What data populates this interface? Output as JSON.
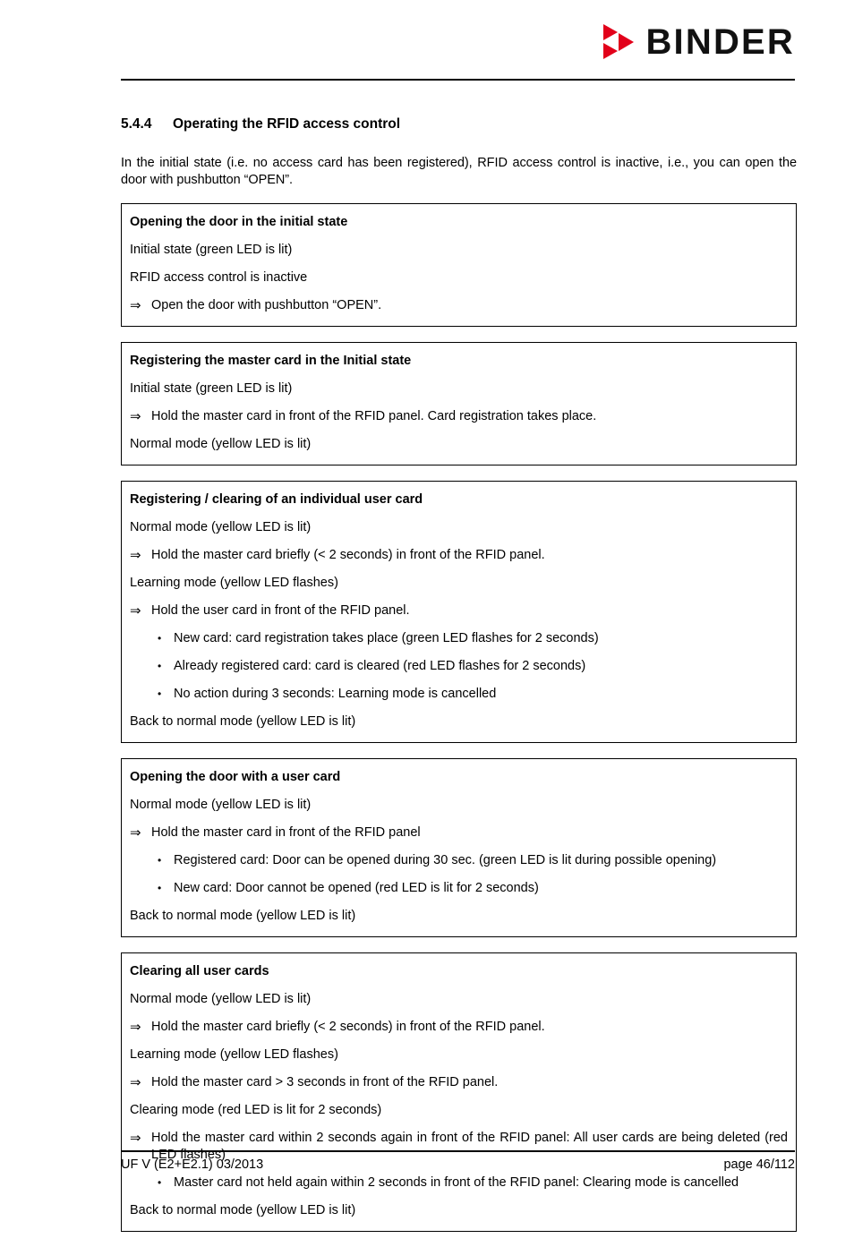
{
  "header": {
    "brand": "BINDER",
    "logo_color": "#e2001a",
    "logo_icon": "binder-triangles-logo"
  },
  "section": {
    "number": "5.4.4",
    "title": "Operating the RFID access control"
  },
  "intro": "In the initial state (i.e. no access card has been registered), RFID access control is inactive, i.e., you can open the door with pushbutton “OPEN”.",
  "glyphs": {
    "arrow": "⇒",
    "bullet": "•"
  },
  "boxes": [
    {
      "title": "Opening the door in the initial state",
      "lines": [
        {
          "type": "plain",
          "text": "Initial state (green LED is lit)"
        },
        {
          "type": "plain",
          "text": "RFID access control is inactive"
        },
        {
          "type": "arrow",
          "text": "Open the door with pushbutton “OPEN”."
        }
      ]
    },
    {
      "title": "Registering the master card in the Initial state",
      "lines": [
        {
          "type": "plain",
          "text": "Initial state (green LED is lit)"
        },
        {
          "type": "arrow",
          "text": "Hold the master card in front of the RFID panel. Card registration takes place."
        },
        {
          "type": "plain",
          "text": "Normal mode (yellow LED is lit)"
        }
      ]
    },
    {
      "title": "Registering / clearing of an individual user card",
      "lines": [
        {
          "type": "plain",
          "text": "Normal mode (yellow LED is lit)"
        },
        {
          "type": "arrow",
          "text": "Hold the master card briefly (< 2 seconds) in front of the RFID panel."
        },
        {
          "type": "plain",
          "text": "Learning mode (yellow LED flashes)"
        },
        {
          "type": "arrow",
          "text": "Hold the user card in front of the RFID panel."
        },
        {
          "type": "bullet",
          "text": "New card: card registration takes place (green LED flashes for 2 seconds)"
        },
        {
          "type": "bullet",
          "text": "Already registered card: card is cleared (red LED flashes for 2 seconds)"
        },
        {
          "type": "bullet",
          "text": "No action during 3 seconds: Learning mode is cancelled"
        },
        {
          "type": "plain",
          "text": "Back to normal mode (yellow LED is lit)"
        }
      ]
    },
    {
      "title": "Opening the door with a user card",
      "lines": [
        {
          "type": "plain",
          "text": "Normal mode (yellow LED is lit)"
        },
        {
          "type": "arrow",
          "text": "Hold the master card in front of the RFID panel"
        },
        {
          "type": "bullet",
          "text": "Registered card: Door can be opened during 30 sec. (green LED is lit during possible opening)"
        },
        {
          "type": "bullet",
          "text": "New card: Door cannot be opened (red LED is lit for 2 seconds)"
        },
        {
          "type": "plain",
          "text": "Back to normal mode (yellow LED is lit)"
        }
      ]
    },
    {
      "title": "Clearing all user cards",
      "lines": [
        {
          "type": "plain",
          "text": "Normal mode (yellow LED is lit)"
        },
        {
          "type": "arrow",
          "text": "Hold the master card briefly (< 2 seconds) in front of the RFID panel."
        },
        {
          "type": "plain",
          "text": "Learning mode (yellow LED flashes)"
        },
        {
          "type": "arrow",
          "text": "Hold the master card > 3 seconds in front of the RFID panel."
        },
        {
          "type": "plain",
          "text": "Clearing mode (red LED is lit for 2 seconds)"
        },
        {
          "type": "arrow",
          "justify": true,
          "text": "Hold the master card within 2 seconds again in front of the RFID panel: All user cards are being deleted (red LED flashes)"
        },
        {
          "type": "bullet",
          "justify": true,
          "text": "Master card not held again within 2 seconds in front of the RFID panel: Clearing mode is cancelled"
        },
        {
          "type": "plain",
          "text": "Back to normal mode (yellow LED is lit)"
        }
      ]
    }
  ],
  "footer": {
    "left": "UF V (E2+E2.1) 03/2013",
    "right": "page 46/112"
  }
}
